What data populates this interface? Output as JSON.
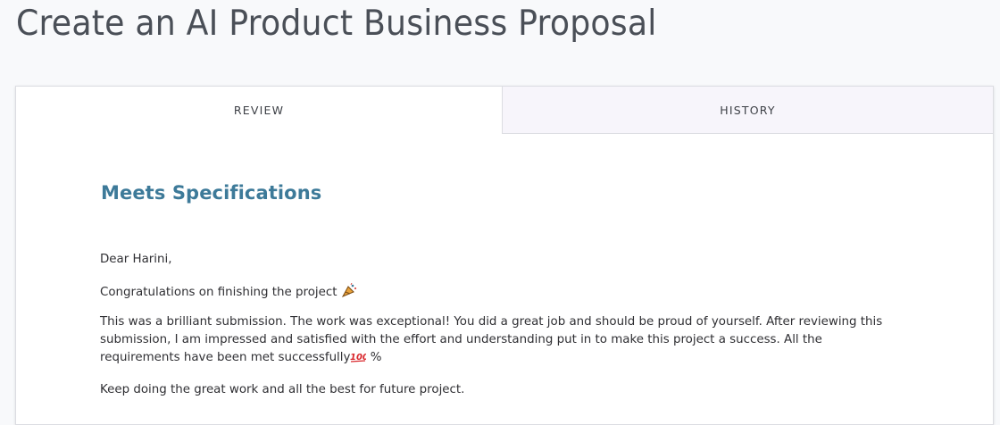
{
  "page": {
    "title": "Create an AI Product Business Proposal"
  },
  "tabs": [
    {
      "label": "REVIEW",
      "active": true
    },
    {
      "label": "HISTORY",
      "active": false
    }
  ],
  "review": {
    "verdict": "Meets Specifications",
    "verdict_color": "#3d7a99",
    "greeting": "Dear Harini,",
    "congrats_text": "Congratulations on finishing the project",
    "congrats_icon": "party-popper-icon",
    "body_text": "This was a brilliant submission. The work was exceptional! You did a great job and should be proud of yourself. After reviewing this submission, I am impressed and satisfied with the effort and understanding put in to make this project a success. All the requirements have been met successfully",
    "body_icon": "hundred-points-icon",
    "body_suffix": " %",
    "closing": "Keep doing the great work and all the best for future project."
  }
}
